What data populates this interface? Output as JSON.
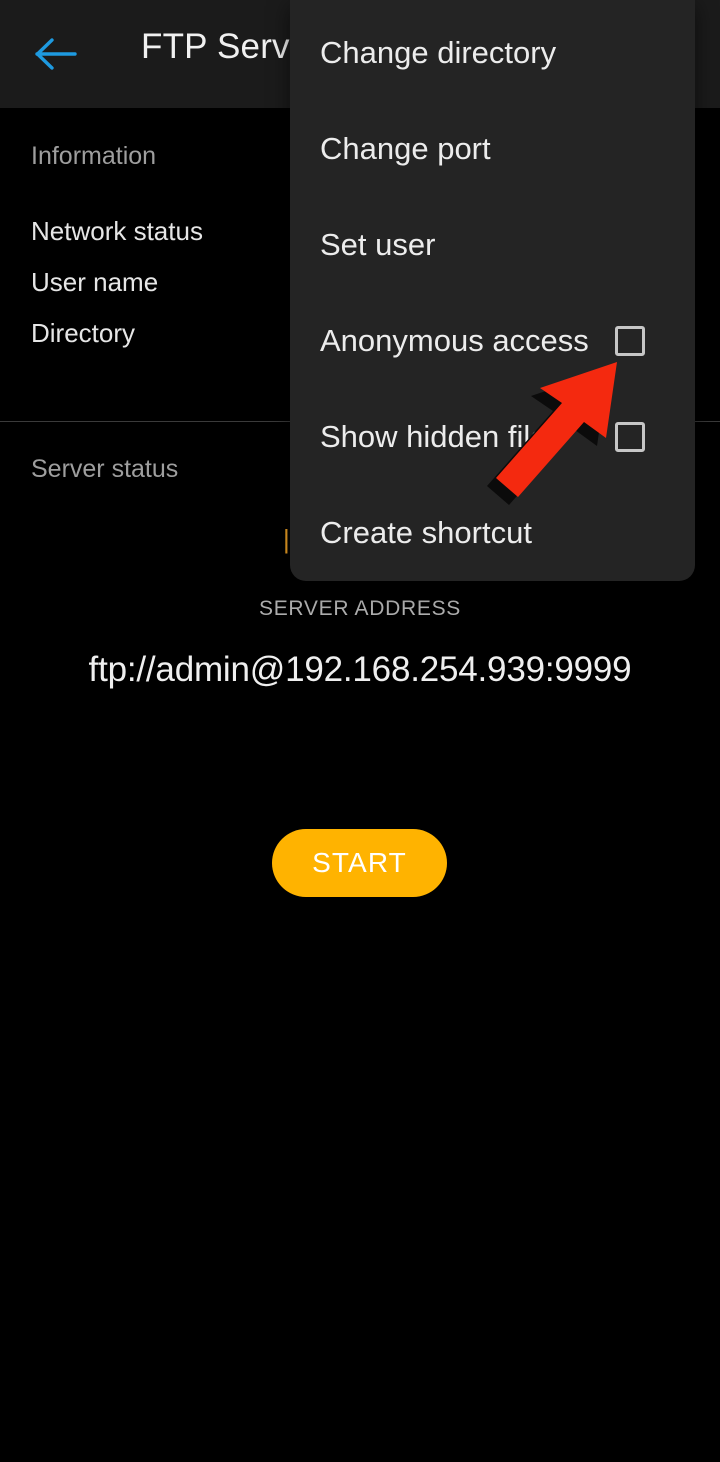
{
  "appbar": {
    "back_icon": "arrow-left-icon",
    "back_color": "#1e9ae0",
    "title": "FTP Server"
  },
  "information": {
    "section_label": "Information",
    "rows": [
      {
        "label": "Network status"
      },
      {
        "label": "User name"
      },
      {
        "label": "Directory"
      }
    ]
  },
  "server_status": {
    "section_label": "Server status",
    "value": "|",
    "value_color": "#f9a825"
  },
  "server_address": {
    "caption": "SERVER ADDRESS",
    "value": "ftp://admin@192.168.254.939:9999"
  },
  "actions": {
    "start_label": "START",
    "start_color": "#ffb300"
  },
  "overflow_menu": {
    "background": "#242424",
    "items": [
      {
        "label": "Change directory",
        "has_checkbox": false,
        "checked": false
      },
      {
        "label": "Change port",
        "has_checkbox": false,
        "checked": false
      },
      {
        "label": "Set user",
        "has_checkbox": false,
        "checked": false
      },
      {
        "label": "Anonymous access",
        "has_checkbox": true,
        "checked": false
      },
      {
        "label": "Show hidden files",
        "has_checkbox": true,
        "checked": false
      },
      {
        "label": "Create shortcut",
        "has_checkbox": false,
        "checked": false
      }
    ]
  },
  "annotation": {
    "type": "arrow",
    "color": "#f4290f",
    "points_to": "Anonymous access checkbox"
  }
}
